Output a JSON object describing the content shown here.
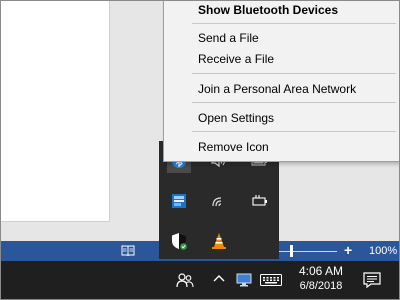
{
  "context_menu": {
    "items": [
      {
        "label": "Show Bluetooth Devices",
        "bold": true
      },
      {
        "label": "Send a File"
      },
      {
        "label": "Receive a File"
      },
      {
        "label": "Join a Personal Area Network"
      },
      {
        "label": "Open Settings"
      },
      {
        "label": "Remove Icon"
      }
    ]
  },
  "word_status": {
    "zoom_percent": "100%",
    "zoom_plus": "+",
    "zoom_level": 1.0
  },
  "taskbar": {
    "time": "4:06 AM",
    "date": "6/8/2018"
  },
  "tray_icons": [
    "bluetooth-icon",
    "volume-icon",
    "battery-icon",
    "onedrive-icon",
    "wifi-icon",
    "power-icon",
    "security-shield-icon",
    "vlc-cone-icon"
  ],
  "colors": {
    "word_blue": "#2b579a",
    "taskbar": "#1f1f1f",
    "menu_bg": "#f2f2f2",
    "bluetooth_blue": "#1e88e5",
    "vlc_orange": "#f08a00",
    "shield_green": "#2e9e44"
  }
}
